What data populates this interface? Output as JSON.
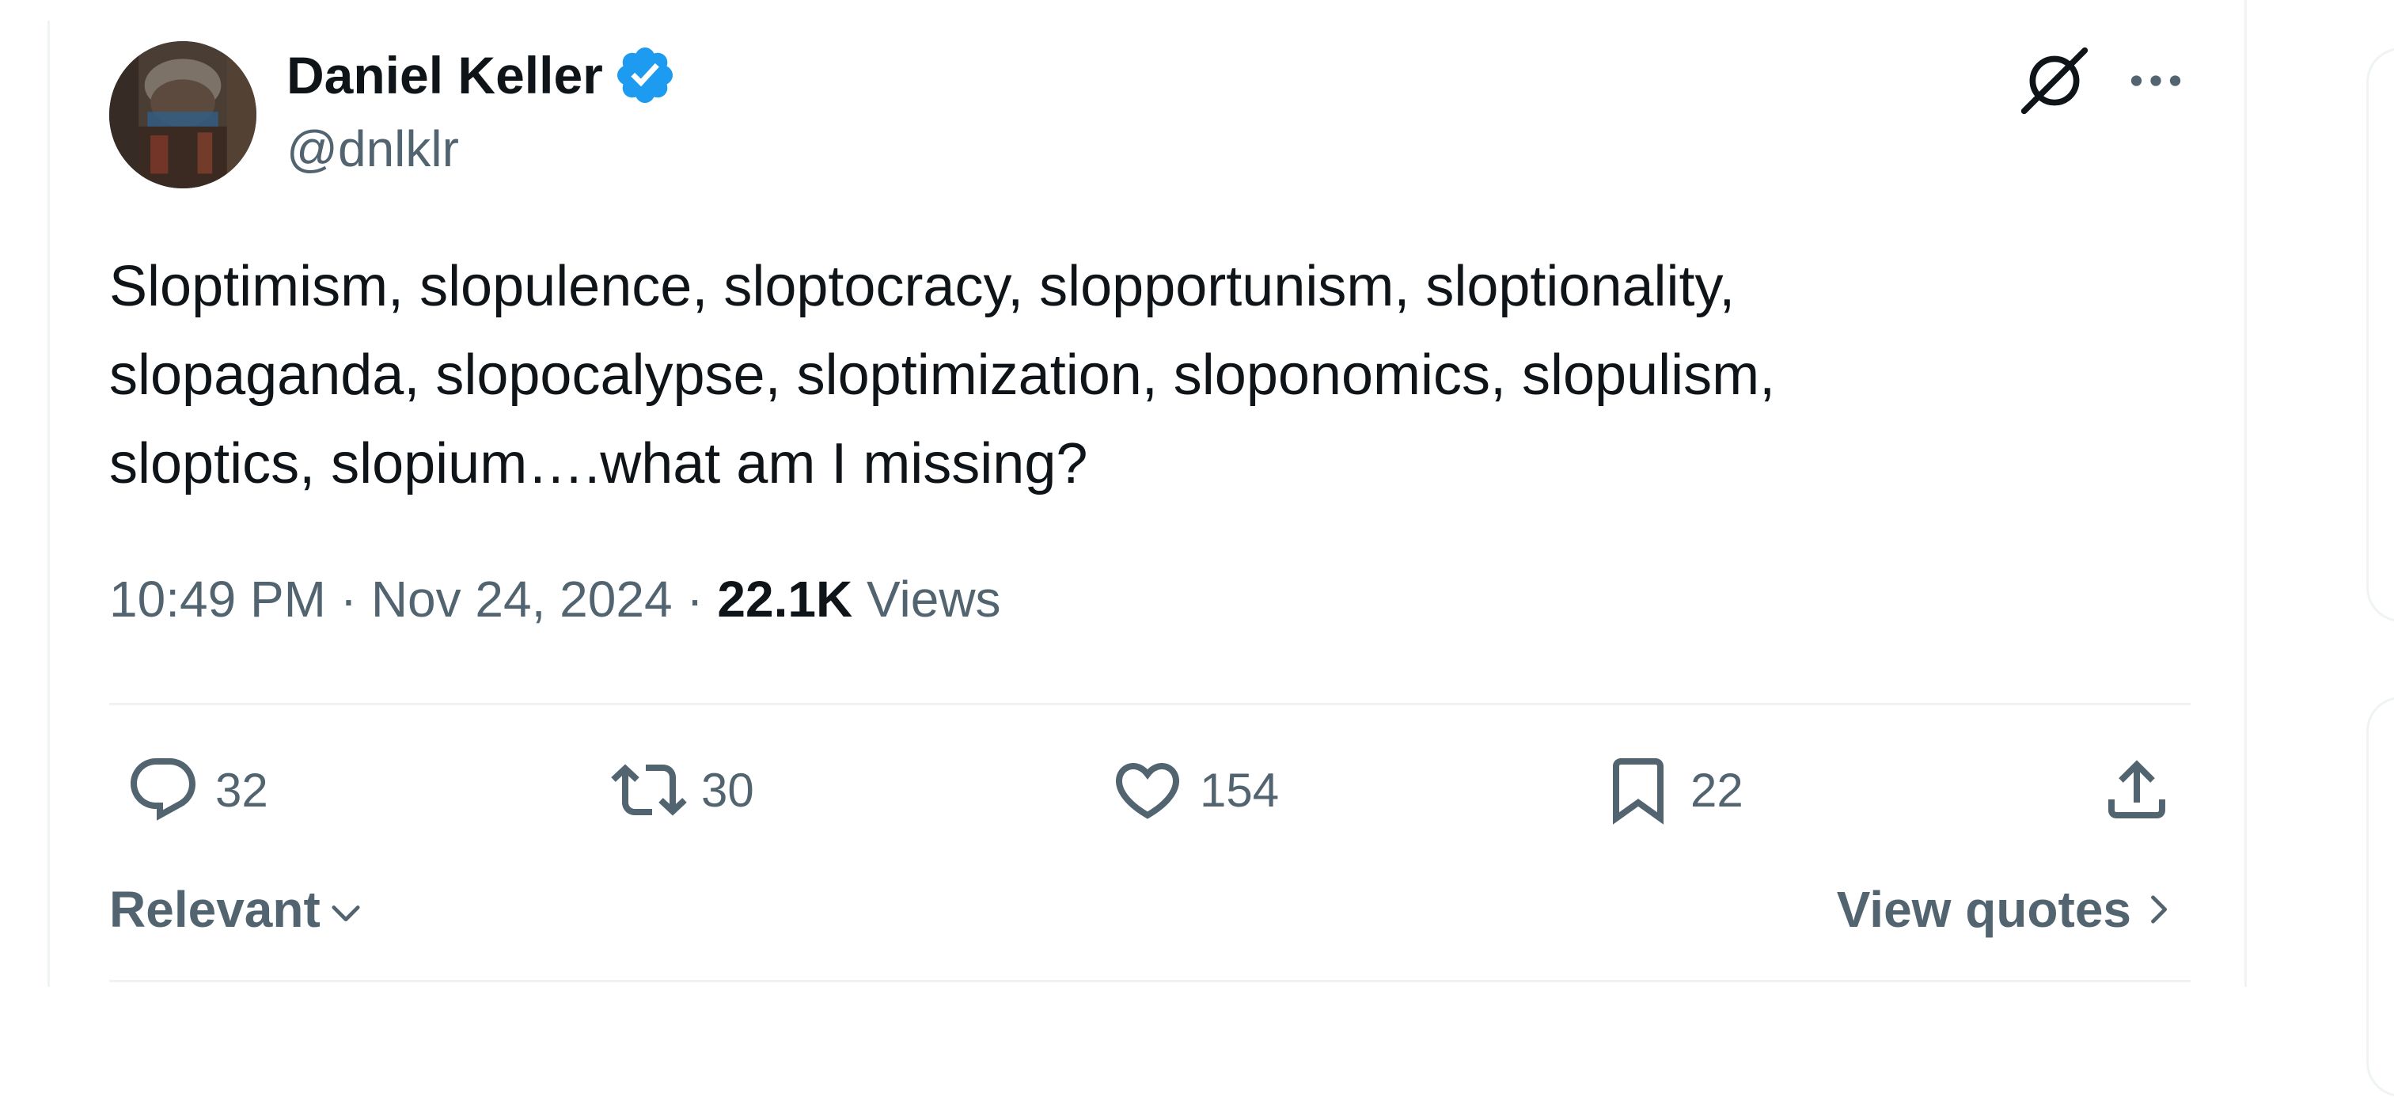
{
  "tweet": {
    "author": {
      "display_name": "Daniel Keller",
      "handle": "@dnlklr",
      "verified": true
    },
    "text": "Sloptimism, slopulence, sloptocracy, slopportunism, sloptionality,\nslopaganda,  slopocalypse, sloptimization, sloponomics, slopulism,\nsloptics, slopium….what am I missing?",
    "time": "10:49 PM",
    "separator": "·",
    "date": "Nov 24, 2024",
    "views_count": "22.1K",
    "views_label": "Views"
  },
  "actions": {
    "replies": "32",
    "reposts": "30",
    "likes": "154",
    "bookmarks": "22"
  },
  "footer": {
    "sort_label": "Relevant",
    "view_quotes_label": "View quotes"
  },
  "icons": {
    "verified": "verified-badge-icon",
    "grok": "grok-icon",
    "more": "more-options-icon",
    "reply": "reply-icon",
    "retweet": "retweet-icon",
    "like": "heart-icon",
    "bookmark": "bookmark-icon",
    "share": "share-icon"
  },
  "colors": {
    "text_primary": "#0f1419",
    "text_secondary": "#536471",
    "verified_blue": "#1d9bf0",
    "divider": "#eff3f4"
  }
}
